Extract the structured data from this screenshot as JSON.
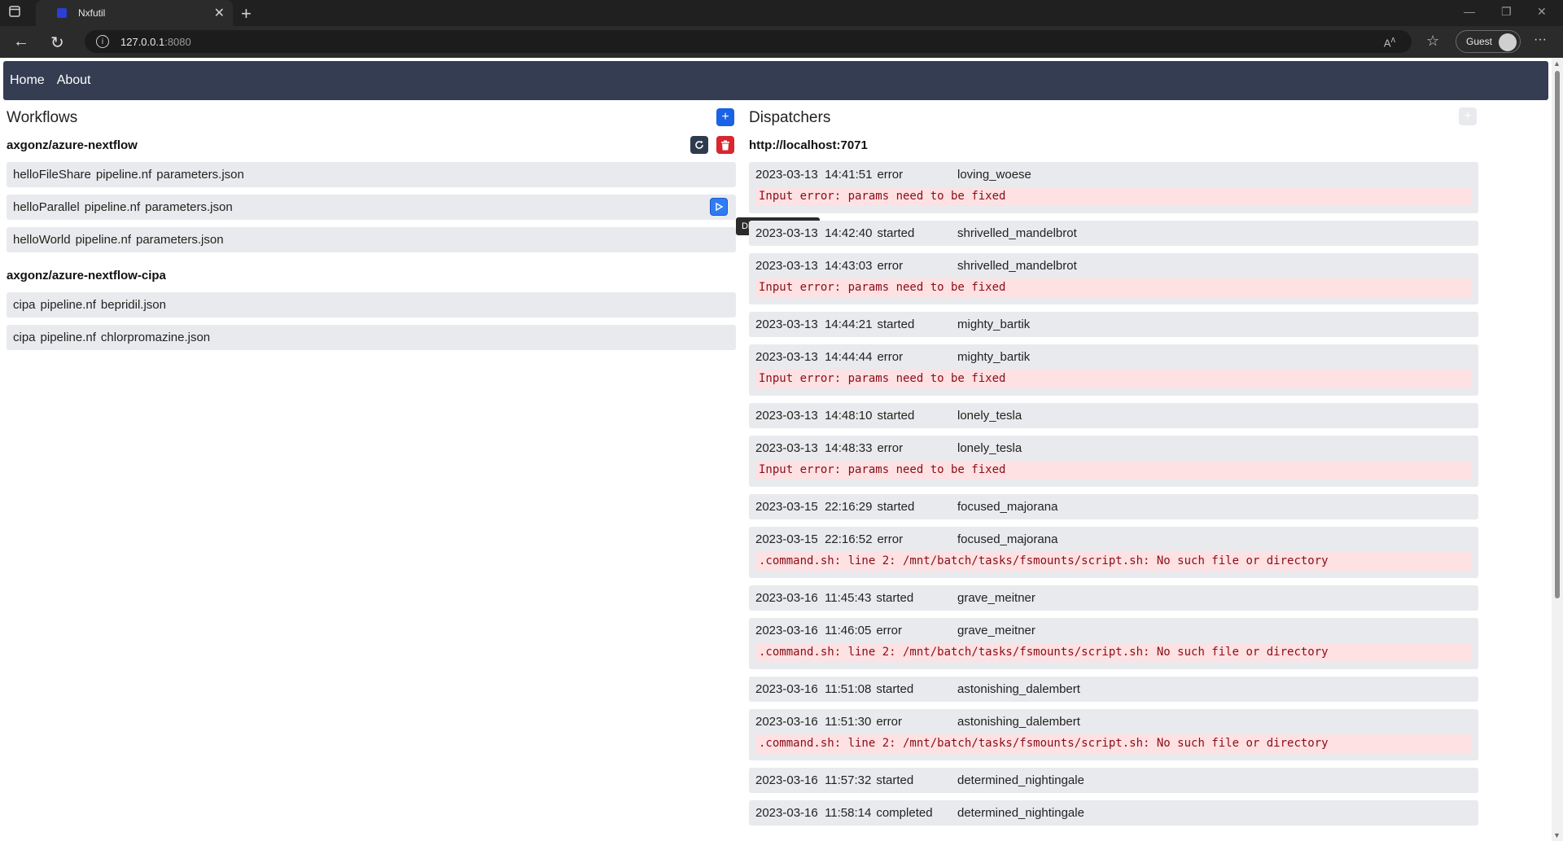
{
  "browser": {
    "tab_title": "Nxfutil",
    "url_host": "127.0.0.1",
    "url_port": ":8080",
    "guest_label": "Guest"
  },
  "nav": {
    "home": "Home",
    "about": "About"
  },
  "workflows": {
    "title": "Workflows",
    "tooltip": "Dispatch workflow",
    "repos": [
      {
        "name": "axgonz/azure-nextflow",
        "items": [
          [
            "helloFileShare",
            "pipeline.nf",
            "parameters.json"
          ],
          [
            "helloParallel",
            "pipeline.nf",
            "parameters.json"
          ],
          [
            "helloWorld",
            "pipeline.nf",
            "parameters.json"
          ]
        ]
      },
      {
        "name": "axgonz/azure-nextflow-cipa",
        "items": [
          [
            "cipa",
            "pipeline.nf",
            "bepridil.json"
          ],
          [
            "cipa",
            "pipeline.nf",
            "chlorpromazine.json"
          ]
        ]
      }
    ]
  },
  "dispatchers": {
    "title": "Dispatchers",
    "host": "http://localhost:7071",
    "events": [
      {
        "time": "2023-03-13  14:41:51",
        "status": "error",
        "name": "loving_woese",
        "error": "Input error: params need to be fixed"
      },
      {
        "time": "2023-03-13  14:42:40",
        "status": "started",
        "name": "shrivelled_mandelbrot"
      },
      {
        "time": "2023-03-13  14:43:03",
        "status": "error",
        "name": "shrivelled_mandelbrot",
        "error": "Input error: params need to be fixed"
      },
      {
        "time": "2023-03-13  14:44:21",
        "status": "started",
        "name": "mighty_bartik"
      },
      {
        "time": "2023-03-13  14:44:44",
        "status": "error",
        "name": "mighty_bartik",
        "error": "Input error: params need to be fixed"
      },
      {
        "time": "2023-03-13  14:48:10",
        "status": "started",
        "name": "lonely_tesla"
      },
      {
        "time": "2023-03-13  14:48:33",
        "status": "error",
        "name": "lonely_tesla",
        "error": "Input error: params need to be fixed"
      },
      {
        "time": "2023-03-15  22:16:29",
        "status": "started",
        "name": "focused_majorana"
      },
      {
        "time": "2023-03-15  22:16:52",
        "status": "error",
        "name": "focused_majorana",
        "error": ".command.sh: line 2: /mnt/batch/tasks/fsmounts/script.sh: No such file or directory"
      },
      {
        "time": "2023-03-16  11:45:43",
        "status": "started",
        "name": "grave_meitner"
      },
      {
        "time": "2023-03-16  11:46:05",
        "status": "error",
        "name": "grave_meitner",
        "error": ".command.sh: line 2: /mnt/batch/tasks/fsmounts/script.sh: No such file or directory"
      },
      {
        "time": "2023-03-16  11:51:08",
        "status": "started",
        "name": "astonishing_dalembert"
      },
      {
        "time": "2023-03-16  11:51:30",
        "status": "error",
        "name": "astonishing_dalembert",
        "error": ".command.sh: line 2: /mnt/batch/tasks/fsmounts/script.sh: No such file or directory"
      },
      {
        "time": "2023-03-16  11:57:32",
        "status": "started",
        "name": "determined_nightingale"
      },
      {
        "time": "2023-03-16  11:58:14",
        "status": "completed",
        "name": "determined_nightingale"
      }
    ]
  }
}
